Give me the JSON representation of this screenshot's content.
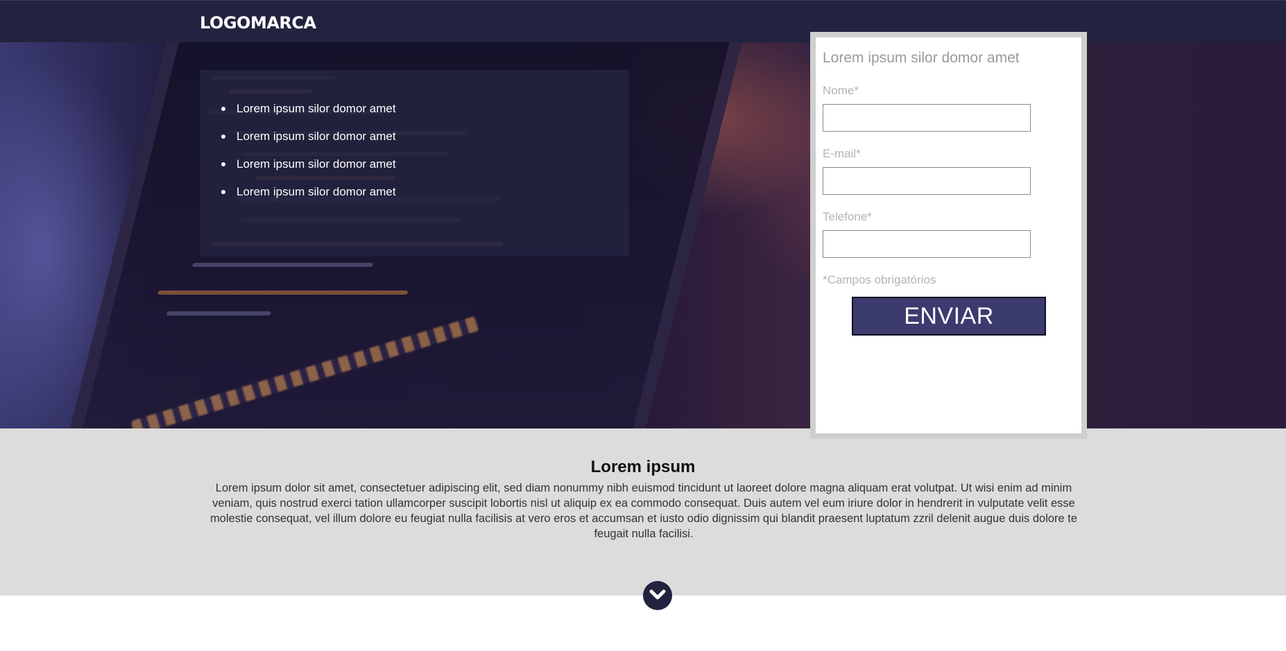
{
  "header": {
    "logo_text": "LOGOMARCA"
  },
  "features": {
    "items": [
      "Lorem ipsum silor domor amet",
      "Lorem ipsum silor domor amet",
      "Lorem ipsum silor domor amet",
      "Lorem ipsum silor domor amet"
    ]
  },
  "form": {
    "title": "Lorem ipsum silor domor amet",
    "name_label": "Nome*",
    "name_value": "",
    "email_label": "E-mail*",
    "email_value": "",
    "phone_label": "Telefone*",
    "phone_value": "",
    "required_note": "*Campos obrigatórios",
    "submit_label": "ENVIAR"
  },
  "info": {
    "title": "Lorem ipsum",
    "body": "Lorem ipsum dolor sit amet, consectetuer adipiscing elit, sed diam nonummy nibh euismod tincidunt ut laoreet dolore magna aliquam erat volutpat. Ut wisi enim ad minim veniam, quis nostrud exerci tation ullamcorper suscipit lobortis nisl ut aliquip ex ea commodo consequat. Duis autem vel eum iriure dolor in hendrerit in vulputate velit esse molestie consequat, vel illum dolore eu feugiat nulla facilisis at vero eros et accumsan et iusto odio dignissim qui blandit praesent luptatum zzril delenit augue duis dolore te feugait nulla facilisi."
  },
  "colors": {
    "primary": "#23233f",
    "button": "#3b3b6e",
    "section_bg": "#dcdcdc",
    "form_border": "#cfcfcf"
  },
  "icons": {
    "scroll_down": "chevron-down-icon"
  }
}
